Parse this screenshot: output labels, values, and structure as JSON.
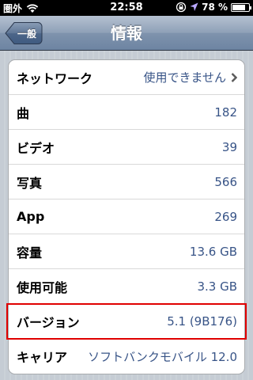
{
  "status_bar": {
    "carrier": "圏外",
    "time": "22:58",
    "battery_percent": "78 %",
    "battery_level": 0.78,
    "icons": [
      "wifi-icon",
      "rotation-lock-icon",
      "location-icon",
      "battery-icon"
    ]
  },
  "nav": {
    "title": "情報",
    "back_label": "一般"
  },
  "rows": [
    {
      "label": "ネットワーク",
      "value": "使用できません",
      "disclosure": true
    },
    {
      "label": "曲",
      "value": "182"
    },
    {
      "label": "ビデオ",
      "value": "39"
    },
    {
      "label": "写真",
      "value": "566"
    },
    {
      "label": "App",
      "value": "269"
    },
    {
      "label": "容量",
      "value": "13.6 GB"
    },
    {
      "label": "使用可能",
      "value": "3.3 GB"
    },
    {
      "label": "バージョン",
      "value": "5.1 (9B176)"
    },
    {
      "label": "キャリア",
      "value": "ソフトバンクモバイル 12.0"
    }
  ],
  "colors": {
    "value_text": "#385487",
    "highlight": "#e00000",
    "navbar": "#6d84a2"
  }
}
